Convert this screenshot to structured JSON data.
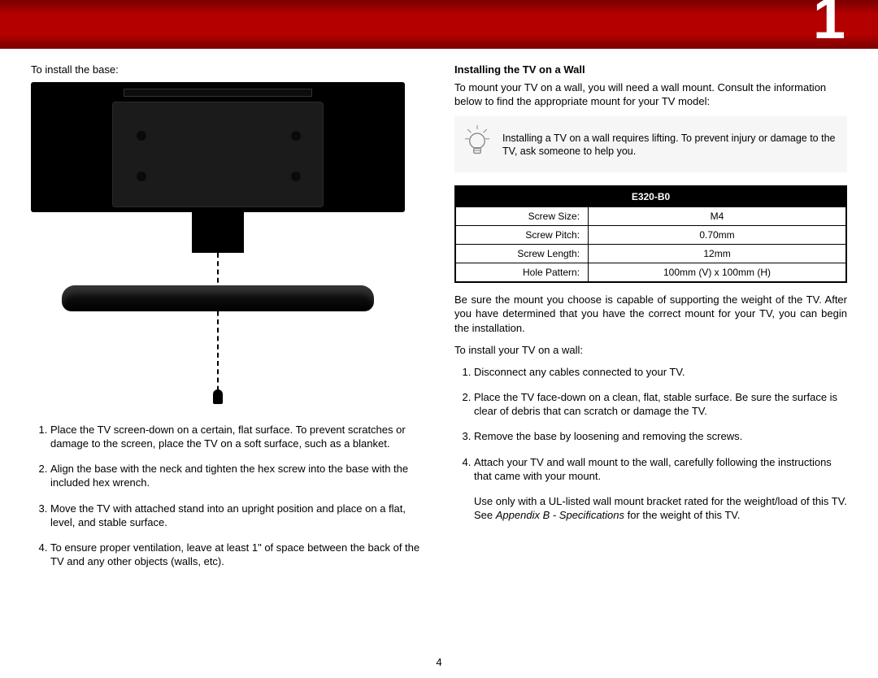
{
  "chapter_number": "1",
  "page_number": "4",
  "left": {
    "lead": "To install the base:",
    "steps": [
      "Place the TV screen-down on a certain, flat surface. To prevent scratches or damage to the screen, place the TV on a soft surface, such as a blanket.",
      "Align the base with the neck and tighten the hex screw into the base with the included hex wrench.",
      "Move the TV with attached stand into an upright position and place on a flat, level, and stable surface.",
      "To ensure proper ventilation, leave at least 1\" of space between the back of the TV and any other objects (walls, etc)."
    ]
  },
  "right": {
    "heading": "Installing the TV on a Wall",
    "intro": "To mount your TV on a wall, you will need a wall mount. Consult the information below to find the appropriate mount for your TV model:",
    "tip": "Installing a TV on a wall requires lifting. To prevent injury or damage to the TV, ask someone to help you.",
    "table": {
      "title": "E320-B0",
      "rows": [
        {
          "k": "Screw Size:",
          "v": "M4"
        },
        {
          "k": "Screw Pitch:",
          "v": "0.70mm"
        },
        {
          "k": "Screw Length:",
          "v": "12mm"
        },
        {
          "k": "Hole Pattern:",
          "v": "100mm (V) x 100mm (H)"
        }
      ]
    },
    "after_table": "Be sure the mount you choose is capable of supporting the weight of the TV. After you have determined that you have the correct mount for your TV, you can begin the installation.",
    "lead2": "To install your TV on a wall:",
    "steps": [
      "Disconnect any cables connected to your TV.",
      "Place the TV face-down on a clean, flat, stable surface. Be sure the surface is clear of debris that can scratch or damage the TV.",
      "Remove the base by loosening and removing the screws.",
      "Attach your TV and wall mount to the wall, carefully following the instructions that came with your mount."
    ],
    "note_pre": "Use only with a UL-listed wall mount bracket rated for the weight/load of this TV. See ",
    "note_ital": "Appendix B - Specifications",
    "note_post": " for the weight of this TV."
  }
}
